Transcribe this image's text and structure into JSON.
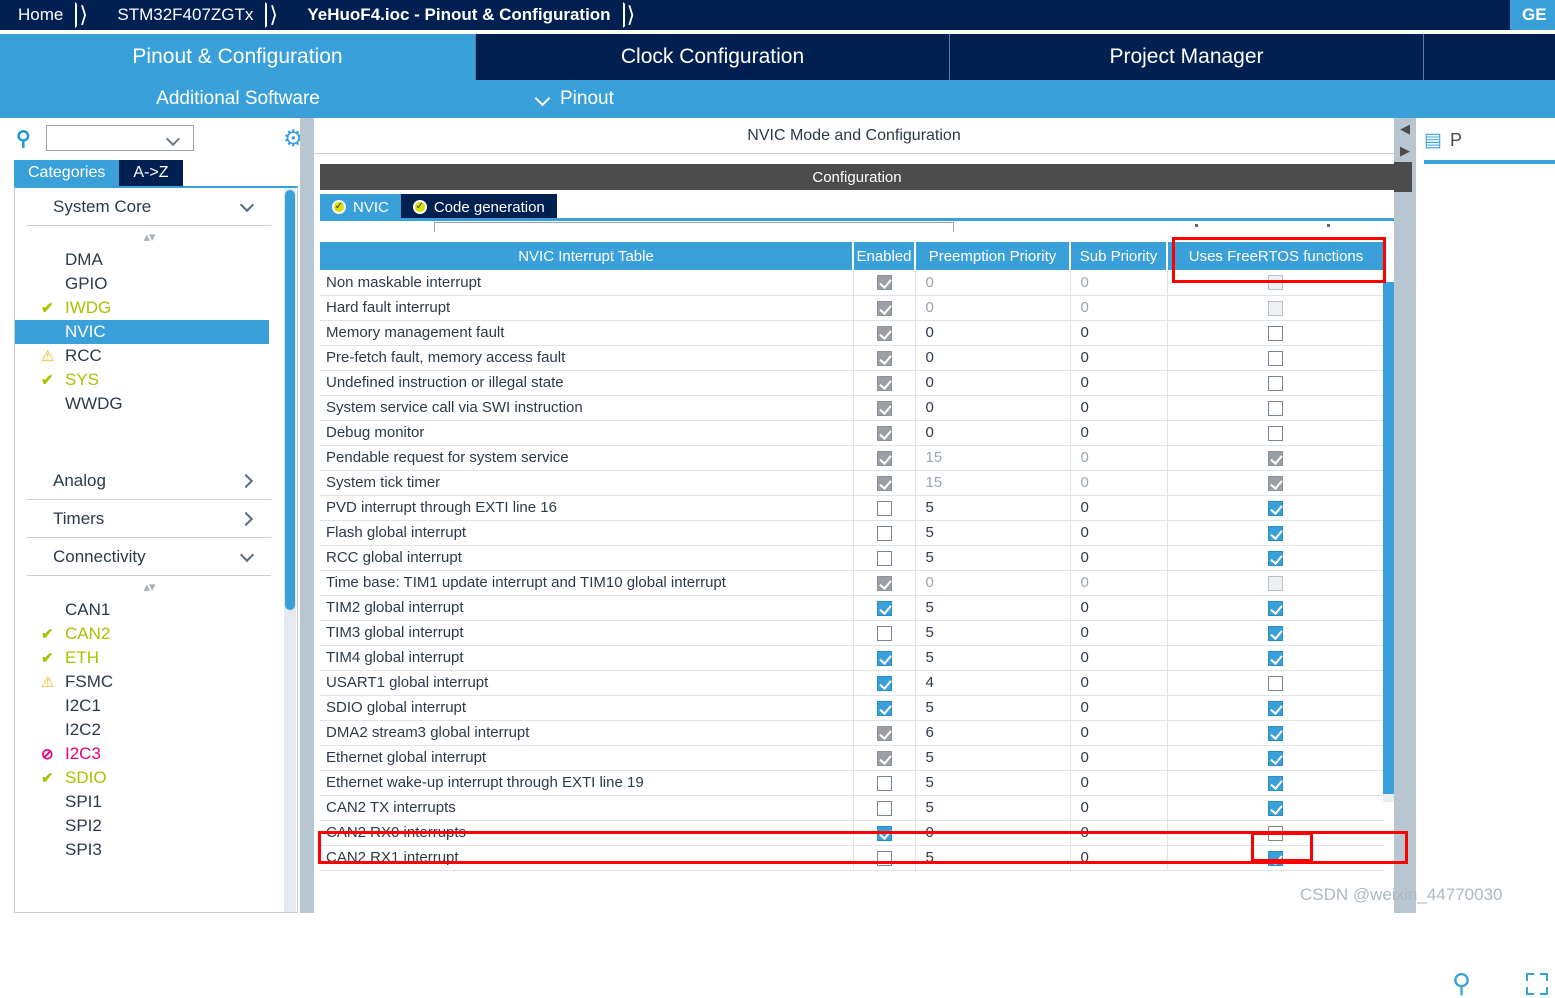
{
  "breadcrumb": {
    "items": [
      "Home",
      "STM32F407ZGTx",
      "YeHuoF4.ioc - Pinout & Configuration"
    ],
    "generate_label": "GE"
  },
  "main_tabs": [
    {
      "label": "Pinout & Configuration",
      "active": true
    },
    {
      "label": "Clock Configuration",
      "active": false
    },
    {
      "label": "Project Manager",
      "active": false
    }
  ],
  "sub_tabs": {
    "additional_software": "Additional Software",
    "pinout": "Pinout"
  },
  "sidebar": {
    "search_value": "",
    "search_icon": "search-icon",
    "gear_icon": "gear-icon",
    "tabs": [
      {
        "label": "Categories",
        "active": true
      },
      {
        "label": "A->Z",
        "active": false
      }
    ],
    "groups": [
      {
        "title": "System Core",
        "expanded": true,
        "items": [
          {
            "label": "DMA",
            "state": "plain",
            "badge": ""
          },
          {
            "label": "GPIO",
            "state": "plain",
            "badge": ""
          },
          {
            "label": "IWDG",
            "state": "ok",
            "badge": "✔"
          },
          {
            "label": "NVIC",
            "state": "selected",
            "badge": ""
          },
          {
            "label": "RCC",
            "state": "warn",
            "badge": "⚠"
          },
          {
            "label": "SYS",
            "state": "ok",
            "badge": "✔"
          },
          {
            "label": "WWDG",
            "state": "plain",
            "badge": ""
          }
        ]
      },
      {
        "title": "Analog",
        "expanded": false,
        "items": []
      },
      {
        "title": "Timers",
        "expanded": false,
        "items": []
      },
      {
        "title": "Connectivity",
        "expanded": true,
        "items": [
          {
            "label": "CAN1",
            "state": "plain",
            "badge": ""
          },
          {
            "label": "CAN2",
            "state": "ok",
            "badge": "✔"
          },
          {
            "label": "ETH",
            "state": "ok",
            "badge": "✔"
          },
          {
            "label": "FSMC",
            "state": "warn",
            "badge": "⚠"
          },
          {
            "label": "I2C1",
            "state": "plain",
            "badge": ""
          },
          {
            "label": "I2C2",
            "state": "plain",
            "badge": ""
          },
          {
            "label": "I2C3",
            "state": "err",
            "badge": "⊘"
          },
          {
            "label": "SDIO",
            "state": "ok",
            "badge": "✔"
          },
          {
            "label": "SPI1",
            "state": "plain",
            "badge": ""
          },
          {
            "label": "SPI2",
            "state": "plain",
            "badge": ""
          },
          {
            "label": "SPI3",
            "state": "plain",
            "badge": ""
          }
        ]
      }
    ]
  },
  "center": {
    "mode_title": "NVIC Mode and Configuration",
    "config_title": "Configuration",
    "inner_tabs": [
      {
        "label": "NVIC",
        "active": true
      },
      {
        "label": "Code generation",
        "active": false
      }
    ]
  },
  "table": {
    "headers": [
      "NVIC Interrupt Table",
      "Enabled",
      "Preemption Priority",
      "Sub Priority",
      "Uses FreeRTOS functions"
    ],
    "rows": [
      {
        "name": "Non maskable interrupt",
        "enabled": "dis-checked",
        "preemption": "0",
        "pp_dim": true,
        "sub": "0",
        "sp_dim": true,
        "rtos": "dis-unchecked"
      },
      {
        "name": "Hard fault interrupt",
        "enabled": "dis-checked",
        "preemption": "0",
        "pp_dim": true,
        "sub": "0",
        "sp_dim": true,
        "rtos": "dis-unchecked"
      },
      {
        "name": "Memory management fault",
        "enabled": "dis-checked",
        "preemption": "0",
        "pp_dim": false,
        "sub": "0",
        "sp_dim": false,
        "rtos": "unchecked"
      },
      {
        "name": "Pre-fetch fault, memory access fault",
        "enabled": "dis-checked",
        "preemption": "0",
        "pp_dim": false,
        "sub": "0",
        "sp_dim": false,
        "rtos": "unchecked"
      },
      {
        "name": "Undefined instruction or illegal state",
        "enabled": "dis-checked",
        "preemption": "0",
        "pp_dim": false,
        "sub": "0",
        "sp_dim": false,
        "rtos": "unchecked"
      },
      {
        "name": "System service call via SWI instruction",
        "enabled": "dis-checked",
        "preemption": "0",
        "pp_dim": false,
        "sub": "0",
        "sp_dim": false,
        "rtos": "unchecked"
      },
      {
        "name": "Debug monitor",
        "enabled": "dis-checked",
        "preemption": "0",
        "pp_dim": false,
        "sub": "0",
        "sp_dim": false,
        "rtos": "unchecked"
      },
      {
        "name": "Pendable request for system service",
        "enabled": "dis-checked",
        "preemption": "15",
        "pp_dim": true,
        "sub": "0",
        "sp_dim": true,
        "rtos": "dis-checked"
      },
      {
        "name": "System tick timer",
        "enabled": "dis-checked",
        "preemption": "15",
        "pp_dim": true,
        "sub": "0",
        "sp_dim": true,
        "rtos": "dis-checked"
      },
      {
        "name": "PVD interrupt through EXTI line 16",
        "enabled": "unchecked",
        "preemption": "5",
        "pp_dim": false,
        "sub": "0",
        "sp_dim": false,
        "rtos": "checked"
      },
      {
        "name": "Flash global interrupt",
        "enabled": "unchecked",
        "preemption": "5",
        "pp_dim": false,
        "sub": "0",
        "sp_dim": false,
        "rtos": "checked"
      },
      {
        "name": "RCC global interrupt",
        "enabled": "unchecked",
        "preemption": "5",
        "pp_dim": false,
        "sub": "0",
        "sp_dim": false,
        "rtos": "checked"
      },
      {
        "name": "Time base: TIM1 update interrupt and TIM10 global interrupt",
        "enabled": "dis-checked",
        "preemption": "0",
        "pp_dim": true,
        "sub": "0",
        "sp_dim": true,
        "rtos": "dis-unchecked"
      },
      {
        "name": "TIM2 global interrupt",
        "enabled": "checked",
        "preemption": "5",
        "pp_dim": false,
        "sub": "0",
        "sp_dim": false,
        "rtos": "checked"
      },
      {
        "name": "TIM3 global interrupt",
        "enabled": "unchecked",
        "preemption": "5",
        "pp_dim": false,
        "sub": "0",
        "sp_dim": false,
        "rtos": "checked"
      },
      {
        "name": "TIM4 global interrupt",
        "enabled": "checked",
        "preemption": "5",
        "pp_dim": false,
        "sub": "0",
        "sp_dim": false,
        "rtos": "checked"
      },
      {
        "name": "USART1 global interrupt",
        "enabled": "checked",
        "preemption": "4",
        "pp_dim": false,
        "sub": "0",
        "sp_dim": false,
        "rtos": "unchecked"
      },
      {
        "name": "SDIO global interrupt",
        "enabled": "checked",
        "preemption": "5",
        "pp_dim": false,
        "sub": "0",
        "sp_dim": false,
        "rtos": "checked"
      },
      {
        "name": "DMA2 stream3 global interrupt",
        "enabled": "dis-checked",
        "preemption": "6",
        "pp_dim": false,
        "sub": "0",
        "sp_dim": false,
        "rtos": "checked"
      },
      {
        "name": "Ethernet global interrupt",
        "enabled": "dis-checked",
        "preemption": "5",
        "pp_dim": false,
        "sub": "0",
        "sp_dim": false,
        "rtos": "checked"
      },
      {
        "name": "Ethernet wake-up interrupt through EXTI line 19",
        "enabled": "unchecked",
        "preemption": "5",
        "pp_dim": false,
        "sub": "0",
        "sp_dim": false,
        "rtos": "checked"
      },
      {
        "name": "CAN2 TX interrupts",
        "enabled": "unchecked",
        "preemption": "5",
        "pp_dim": false,
        "sub": "0",
        "sp_dim": false,
        "rtos": "checked"
      },
      {
        "name": "CAN2 RX0 interrupts",
        "enabled": "checked",
        "preemption": "0",
        "pp_dim": false,
        "sub": "0",
        "sp_dim": false,
        "rtos": "unchecked"
      },
      {
        "name": "CAN2 RX1 interrupt",
        "enabled": "unchecked",
        "preemption": "5",
        "pp_dim": false,
        "sub": "0",
        "sp_dim": false,
        "rtos": "checked"
      }
    ]
  },
  "right_panel": {
    "pinout_label": "P",
    "chip_icon": "chip-icon",
    "zoom_icon": "zoom-in-icon",
    "fullscreen_icon": "fullscreen-icon"
  },
  "watermark": "CSDN @weixin_44770030",
  "colors": {
    "accent": "#39a0da",
    "dark_navy": "#002052",
    "annotation_red": "#ff0000",
    "ok_green": "#a4c400",
    "warn_yellow": "#f5b301",
    "error_pink": "#e6007e"
  }
}
